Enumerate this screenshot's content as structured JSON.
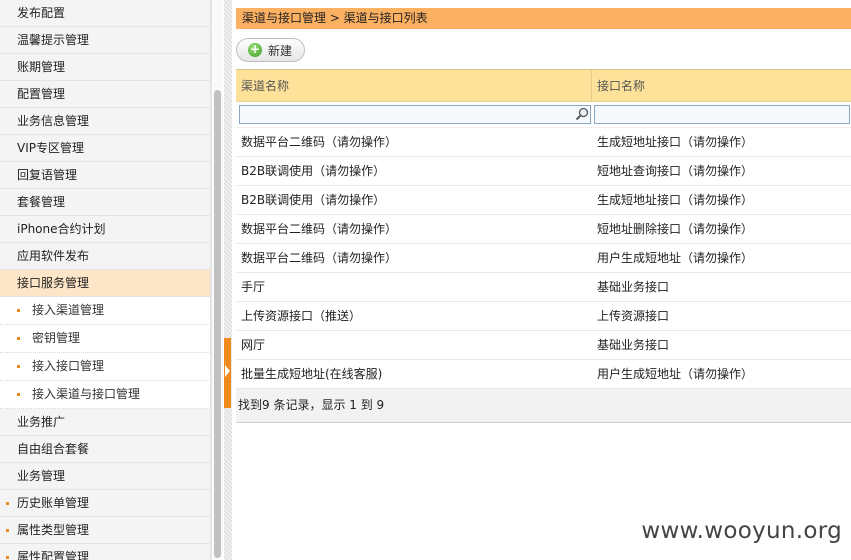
{
  "sidebar": {
    "items_top": [
      {
        "label": "发布配置"
      },
      {
        "label": "温馨提示管理"
      },
      {
        "label": "账期管理"
      },
      {
        "label": "配置管理"
      },
      {
        "label": "业务信息管理"
      },
      {
        "label": "VIP专区管理"
      },
      {
        "label": "回复语管理"
      },
      {
        "label": "套餐管理"
      },
      {
        "label": "iPhone合约计划"
      },
      {
        "label": "应用软件发布"
      }
    ],
    "active_item": {
      "label": "接口服务管理"
    },
    "sub_items": [
      {
        "label": "接入渠道管理"
      },
      {
        "label": "密钥管理"
      },
      {
        "label": "接入接口管理"
      },
      {
        "label": "接入渠道与接口管理"
      }
    ],
    "items_bottom": [
      {
        "label": "业务推广"
      },
      {
        "label": "自由组合套餐"
      },
      {
        "label": "业务管理"
      },
      {
        "label": "历史账单管理"
      },
      {
        "label": "属性类型管理"
      },
      {
        "label": "属性配置管理"
      }
    ]
  },
  "breadcrumb": "渠道与接口管理 > 渠道与接口列表",
  "toolbar": {
    "new_label": "新建"
  },
  "grid": {
    "columns": [
      "渠道名称",
      "接口名称"
    ],
    "rows": [
      [
        "数据平台二维码（请勿操作）",
        "生成短地址接口（请勿操作）"
      ],
      [
        "B2B联调使用（请勿操作）",
        "短地址查询接口（请勿操作）"
      ],
      [
        "B2B联调使用（请勿操作）",
        "生成短地址接口（请勿操作）"
      ],
      [
        "数据平台二维码（请勿操作）",
        "短地址删除接口（请勿操作）"
      ],
      [
        "数据平台二维码（请勿操作）",
        "用户生成短地址（请勿操作）"
      ],
      [
        "手厅",
        "基础业务接口"
      ],
      [
        "上传资源接口（推送）",
        "上传资源接口"
      ],
      [
        "网厅",
        "基础业务接口"
      ],
      [
        "批量生成短地址(在线客服)",
        "用户生成短地址（请勿操作）"
      ]
    ],
    "footer": "找到9 条记录，显示 1 到 9"
  },
  "watermark": "www.wooyun.org",
  "colors": {
    "accent": "#fbb062",
    "header": "#fee29a",
    "active": "#fde6c7",
    "bullet": "#f08a1c"
  }
}
